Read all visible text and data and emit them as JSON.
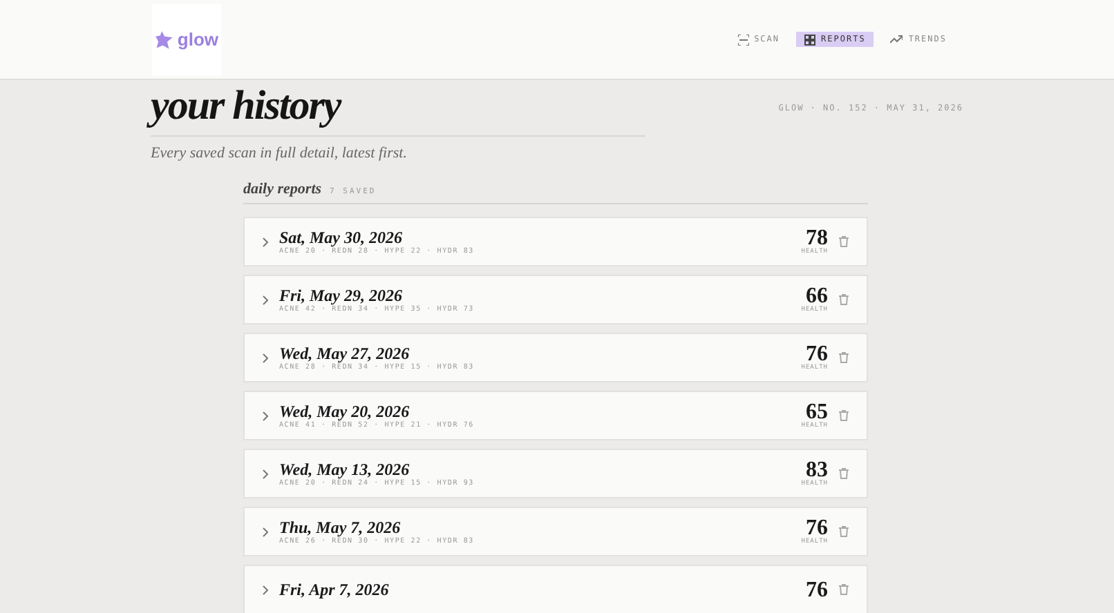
{
  "header": {
    "logo_text": "glow",
    "nav": [
      {
        "label": "SCAN",
        "selected": false
      },
      {
        "label": "REPORTS",
        "selected": true
      },
      {
        "label": "TRENDS",
        "selected": false
      }
    ]
  },
  "page": {
    "title": "your history",
    "meta": "GLOW · NO. 152 · MAY 31, 2026",
    "subtitle": "Every saved scan in full detail, latest first."
  },
  "section": {
    "title": "daily reports",
    "count": "7 SAVED"
  },
  "reports": [
    {
      "date": "Sat, May 30, 2026",
      "metrics": "ACNE 20 · REDN 28 · HYPE 22 · HYDR 83",
      "score": "78",
      "score_label": "HEALTH"
    },
    {
      "date": "Fri, May 29, 2026",
      "metrics": "ACNE 42 · REDN 34 · HYPE 35 · HYDR 73",
      "score": "66",
      "score_label": "HEALTH"
    },
    {
      "date": "Wed, May 27, 2026",
      "metrics": "ACNE 28 · REDN 34 · HYPE 15 · HYDR 83",
      "score": "76",
      "score_label": "HEALTH"
    },
    {
      "date": "Wed, May 20, 2026",
      "metrics": "ACNE 41 · REDN 52 · HYPE 21 · HYDR 76",
      "score": "65",
      "score_label": "HEALTH"
    },
    {
      "date": "Wed, May 13, 2026",
      "metrics": "ACNE 20 · REDN 24 · HYPE 15 · HYDR 93",
      "score": "83",
      "score_label": "HEALTH"
    },
    {
      "date": "Thu, May 7, 2026",
      "metrics": "ACNE 26 · REDN 30 · HYPE 22 · HYDR 83",
      "score": "76",
      "score_label": "HEALTH"
    },
    {
      "date": "Fri, Apr 7, 2026",
      "score": "76"
    }
  ]
}
